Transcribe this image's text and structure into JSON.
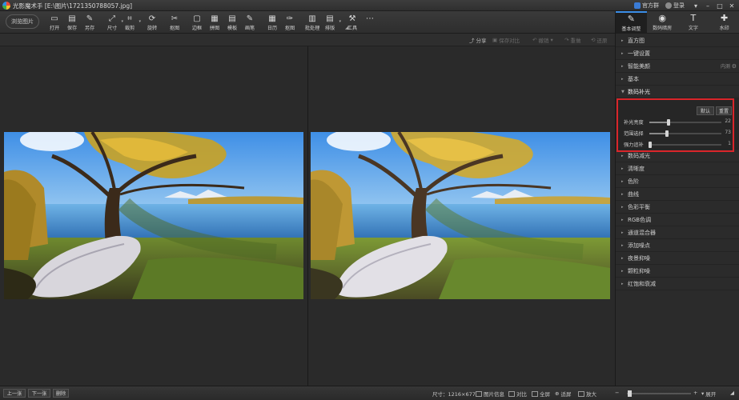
{
  "titlebar": {
    "app_title": "光影魔术手 [E:\\图片\\1721350788057.jpg]",
    "official_group": "官方群",
    "login": "登录"
  },
  "toolbar": {
    "browse": "浏览图片",
    "tools": [
      {
        "label": "打开",
        "icon": "open-icon"
      },
      {
        "label": "保存",
        "icon": "save-icon"
      },
      {
        "label": "另存",
        "icon": "save-as-icon"
      },
      {
        "label": "尺寸",
        "icon": "resize-icon"
      },
      {
        "label": "裁剪",
        "icon": "crop-icon"
      },
      {
        "label": "旋转",
        "icon": "rotate-icon"
      },
      {
        "label": "抠图",
        "icon": "cutout-icon"
      },
      {
        "label": "边框",
        "icon": "frame-icon"
      },
      {
        "label": "拼图",
        "icon": "collage-icon"
      },
      {
        "label": "模板",
        "icon": "template-icon"
      },
      {
        "label": "画笔",
        "icon": "brush-icon"
      },
      {
        "label": "日历",
        "icon": "calendar-icon"
      },
      {
        "label": "抠图",
        "icon": "pin-icon"
      },
      {
        "label": "批处理",
        "icon": "batch-icon"
      },
      {
        "label": "排版",
        "icon": "layout-icon"
      },
      {
        "label": "工具",
        "icon": "wrench-icon"
      },
      {
        "label": "",
        "icon": "more-icon"
      }
    ]
  },
  "subbar": {
    "share": "分享",
    "save_compare": "保存对比",
    "undo": "撤销",
    "redo": "重做",
    "restore": "还原"
  },
  "right_tabs": [
    {
      "label": "基本调整",
      "icon": "adjust-icon",
      "active": true
    },
    {
      "label": "数码暗房",
      "icon": "darkroom-icon",
      "active": false
    },
    {
      "label": "文字",
      "icon": "text-icon",
      "active": false
    },
    {
      "label": "水印",
      "icon": "watermark-icon",
      "active": false
    }
  ],
  "sections_top": [
    {
      "label": "直方图"
    },
    {
      "label": "一键设置"
    },
    {
      "label": "智能美颜",
      "extra": "内测"
    },
    {
      "label": "基本"
    },
    {
      "label": "数码补光",
      "open": true
    }
  ],
  "fill_light": {
    "default_btn": "默认",
    "reset_btn": "重置",
    "sliders": [
      {
        "label": "补光亮度",
        "value": 22,
        "pos": 0.27
      },
      {
        "label": "范围选择",
        "value": 73,
        "pos": 0.24
      },
      {
        "label": "强力追补",
        "value": 1,
        "pos": 0.01
      }
    ]
  },
  "sections_bottom": [
    {
      "label": "数码减光"
    },
    {
      "label": "清晰度"
    },
    {
      "label": "色阶"
    },
    {
      "label": "曲线"
    },
    {
      "label": "色彩平衡"
    },
    {
      "label": "RGB色调"
    },
    {
      "label": "通道混合器"
    },
    {
      "label": "添加噪点"
    },
    {
      "label": "夜景抑噪"
    },
    {
      "label": "颗粒抑噪"
    },
    {
      "label": "红饱和衰减"
    }
  ],
  "statusbar": {
    "prev": "上一张",
    "next": "下一张",
    "delete": "删除",
    "size": "尺寸：1216×677",
    "info": "图片信息",
    "compare": "对比",
    "fullscreen": "全屏",
    "fit": "适屏",
    "zoom_in": "放大",
    "zoom_level": 0.04,
    "expand": "展开"
  }
}
